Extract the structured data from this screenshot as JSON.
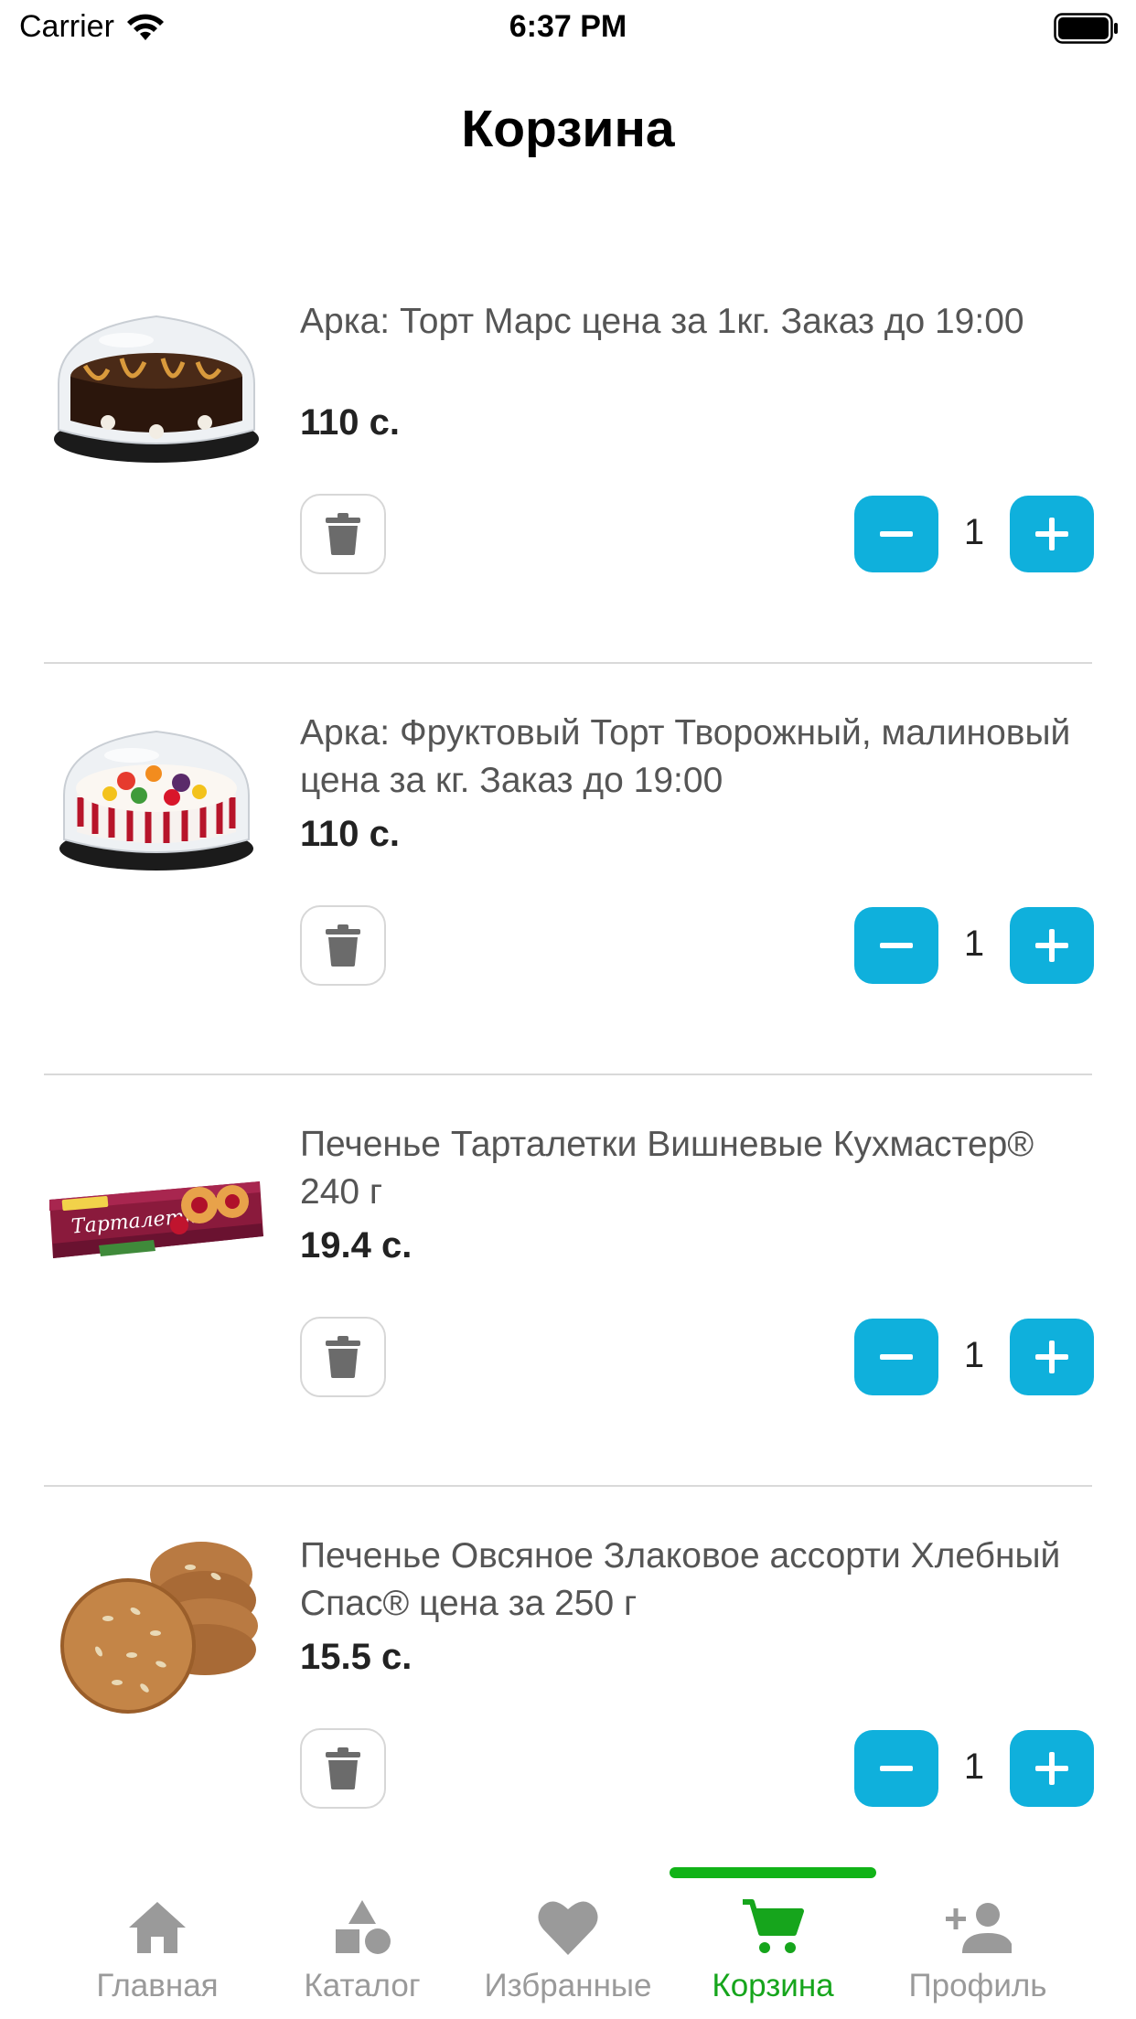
{
  "status_bar": {
    "carrier": "Carrier",
    "time": "6:37 PM"
  },
  "header": {
    "title": "Корзина"
  },
  "cart": {
    "items": [
      {
        "name": "Арка: Торт Марс цена за 1кг. Заказ до 19:00",
        "price": "110 с.",
        "quantity": "1",
        "image": "chocolate-cake"
      },
      {
        "name": "Арка: Фруктовый Торт Творожный, малиновый цена за кг. Заказ до 19:00",
        "price": "110 с.",
        "quantity": "1",
        "image": "fruit-cake"
      },
      {
        "name": "Печенье Тарталетки Вишневые Кухмастер® 240 г",
        "price": "19.4 с.",
        "quantity": "1",
        "image": "cookie-pack"
      },
      {
        "name": "Печенье Овсяное Злаковое ассорти Хлебный Спас® цена за 250 г",
        "price": "15.5 с.",
        "quantity": "1",
        "image": "oat-cookies"
      }
    ]
  },
  "tab_bar": {
    "tabs": [
      {
        "label": "Главная",
        "icon": "home-icon",
        "active": false
      },
      {
        "label": "Каталог",
        "icon": "catalog-icon",
        "active": false
      },
      {
        "label": "Избранные",
        "icon": "heart-icon",
        "active": false
      },
      {
        "label": "Корзина",
        "icon": "cart-icon",
        "active": true
      },
      {
        "label": "Профиль",
        "icon": "add-person-icon",
        "active": false
      }
    ]
  },
  "colors": {
    "accent_blue": "#0fb0dc",
    "active_green": "#16a51c",
    "inactive_gray": "#9a9a9a"
  }
}
